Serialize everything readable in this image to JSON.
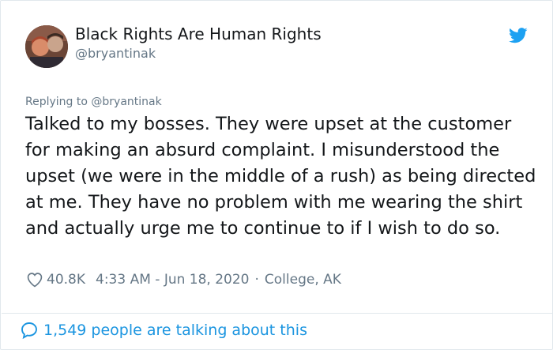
{
  "author": {
    "display_name": "Black Rights Are Human Rights",
    "handle": "@bryantinak"
  },
  "reply": {
    "prefix": "Replying to",
    "handle": "@bryantinak"
  },
  "tweet": {
    "text": "Talked to my bosses. They were upset at the customer for making an absurd complaint. I misunderstood the upset (we were in the middle of a rush) as being directed at me. They have no problem with me wearing the shirt and actually urge me to continue to if I wish to do so."
  },
  "meta": {
    "likes": "40.8K",
    "timestamp": "4:33 AM - Jun 18, 2020",
    "separator": "·",
    "location": "College, AK"
  },
  "footer": {
    "talking": "1,549 people are talking about this"
  },
  "icons": {
    "brand": "twitter-bird-icon",
    "like": "heart-icon",
    "conversation": "speech-bubble-icon"
  },
  "colors": {
    "twitter_blue": "#1da1f2",
    "link_blue": "#1b95e0",
    "secondary_text": "#657786",
    "primary_text": "#14171a",
    "border": "#e1e8ed"
  }
}
